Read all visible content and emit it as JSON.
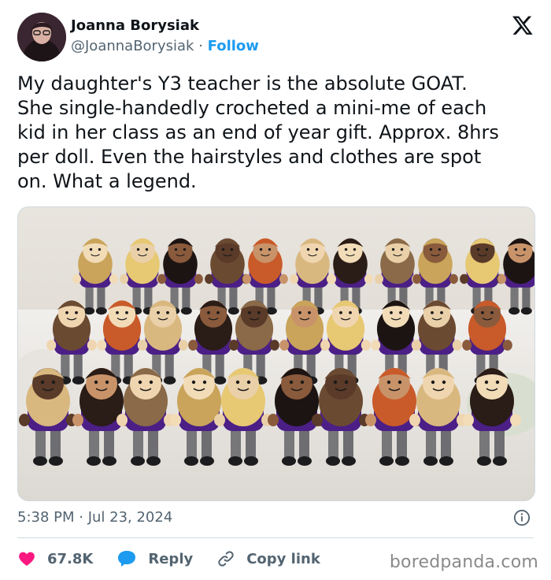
{
  "author": {
    "name": "Joanna Borysiak",
    "handle": "@JoannaBorysiak",
    "separator": "·",
    "follow_label": "Follow"
  },
  "tweet": {
    "text": "My daughter's Y3 teacher is the absolute GOAT.\nShe single-handedly crocheted a mini-me of each\nkid in her class as an end of year gift. Approx. 8hrs\nper doll. Even the hairstyles and clothes are spot\non. What a legend.",
    "timestamp": "5:38 PM · Jul 23, 2024"
  },
  "actions": {
    "likes_count": "67.8K",
    "reply_label": "Reply",
    "copy_link_label": "Copy link"
  },
  "watermark": "boredpanda.com",
  "icons": {
    "brand": "x-logo-icon",
    "info": "info-icon",
    "like": "heart-icon",
    "reply": "speech-bubble-icon",
    "copy": "link-icon"
  },
  "colors": {
    "link": "#1d9bf0",
    "like": "#f91880",
    "reply": "#1d9bf0",
    "secondary_text": "#536471",
    "uniform": "#4b1f86"
  }
}
